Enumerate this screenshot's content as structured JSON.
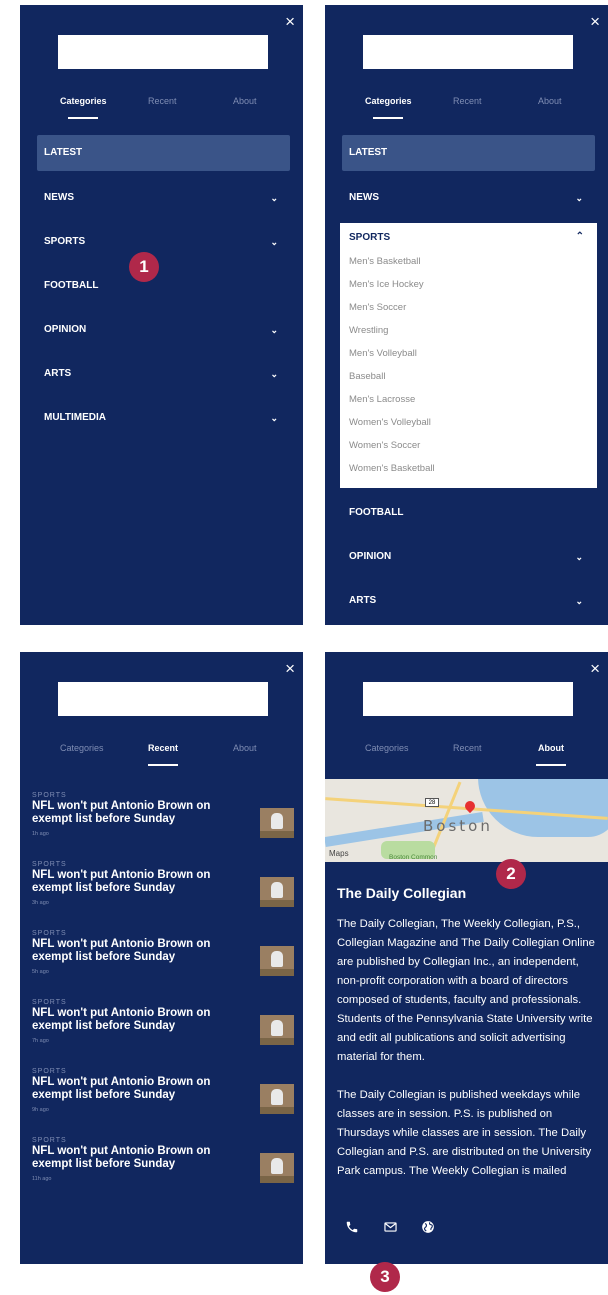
{
  "close_glyph": "×",
  "tabs": {
    "categories": "Categories",
    "recent": "Recent",
    "about": "About"
  },
  "nav": {
    "latest": "LATEST",
    "news": "NEWS",
    "sports": "SPORTS",
    "football": "FOOTBALL",
    "opinion": "OPINION",
    "arts": "ARTS",
    "multimedia": "MULTIMEDIA"
  },
  "sports_sub": [
    "Men's Basketball",
    "Men's Ice Hockey",
    "Men's Soccer",
    "Wrestling",
    "Men's Volleyball",
    "Baseball",
    "Men's Lacrosse",
    "Women's Volleyball",
    "Women's Soccer",
    "Women's Basketball"
  ],
  "recent": {
    "items": [
      {
        "category": "SPORTS",
        "headline": "NFL won't put Antonio Brown on exempt list before Sunday",
        "age": "1h ago"
      },
      {
        "category": "SPORTS",
        "headline": "NFL won't put Antonio Brown on exempt list before Sunday",
        "age": "3h ago"
      },
      {
        "category": "SPORTS",
        "headline": "NFL won't put Antonio Brown on exempt list before Sunday",
        "age": "5h ago"
      },
      {
        "category": "SPORTS",
        "headline": "NFL won't put Antonio Brown on exempt list before Sunday",
        "age": "7h ago"
      },
      {
        "category": "SPORTS",
        "headline": "NFL won't put Antonio Brown on exempt list before Sunday",
        "age": "9h ago"
      },
      {
        "category": "SPORTS",
        "headline": "NFL won't put Antonio Brown on exempt list before Sunday",
        "age": "11h ago"
      }
    ]
  },
  "about": {
    "map": {
      "city": "Boston",
      "brand": "Maps",
      "park": "Boston Common",
      "shield": "28"
    },
    "title": "The Daily Collegian",
    "paragraphs": [
      "The Daily Collegian, The Weekly Collegian, P.S., Collegian Magazine and The Daily Collegian Online are published by Collegian Inc., an independent, non-profit corporation with a board of directors composed of students, faculty and professionals. Students of the Pennsylvania State University write and edit all publications and solicit advertising material for them.",
      "The Daily Collegian is published weekdays while classes are in session. P.S. is published on Thursdays while classes are in session. The Daily Collegian and P.S. are distributed on the University Park campus. The Weekly Collegian is mailed"
    ]
  },
  "markers": {
    "one": "1",
    "two": "2",
    "three": "3"
  },
  "colors": {
    "panel_bg": "#11275f",
    "active_row": "#3a5488",
    "marker": "#b0284a"
  },
  "icons": [
    "close-icon",
    "chevron-down-icon",
    "chevron-up-icon",
    "phone-icon",
    "mail-icon",
    "globe-icon"
  ]
}
